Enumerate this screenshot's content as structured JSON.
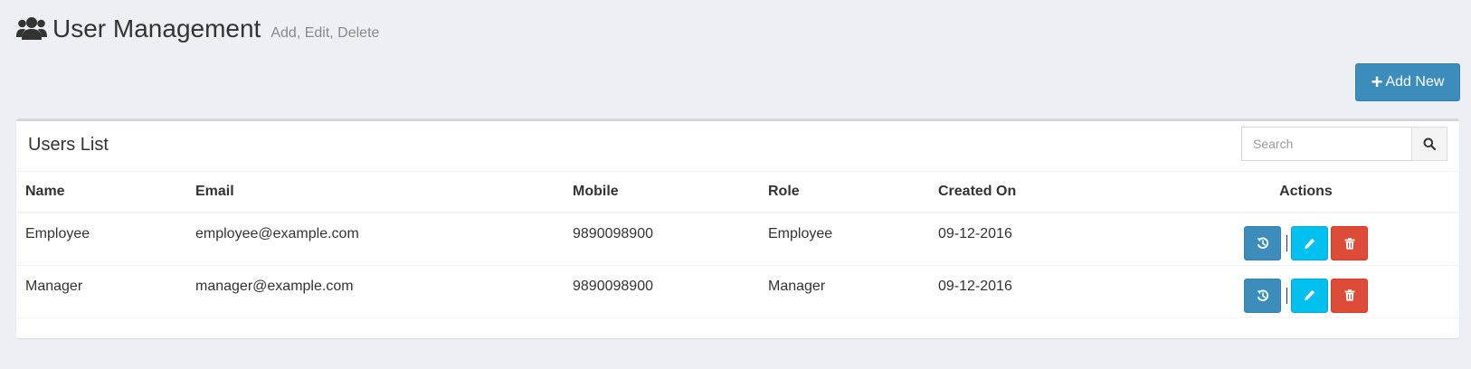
{
  "header": {
    "title": "User Management",
    "subtitle": "Add, Edit, Delete"
  },
  "add_button": {
    "label": "Add New"
  },
  "box": {
    "title": "Users List",
    "search": {
      "placeholder": "Search",
      "value": ""
    }
  },
  "table": {
    "columns": [
      "Name",
      "Email",
      "Mobile",
      "Role",
      "Created On",
      "Actions"
    ],
    "rows": [
      {
        "name": "Employee",
        "email": "employee@example.com",
        "mobile": "9890098900",
        "role": "Employee",
        "created_on": "09-12-2016"
      },
      {
        "name": "Manager",
        "email": "manager@example.com",
        "mobile": "9890098900",
        "role": "Manager",
        "created_on": "09-12-2016"
      }
    ]
  },
  "icons": {
    "header": "users-icon",
    "add": "plus-icon",
    "search": "search-icon",
    "history": "history-icon",
    "edit": "pencil-icon",
    "delete": "trash-icon"
  },
  "colors": {
    "primary": "#3c8dbc",
    "info": "#00c0ef",
    "danger": "#dd4b39",
    "background": "#ecf0f5"
  }
}
